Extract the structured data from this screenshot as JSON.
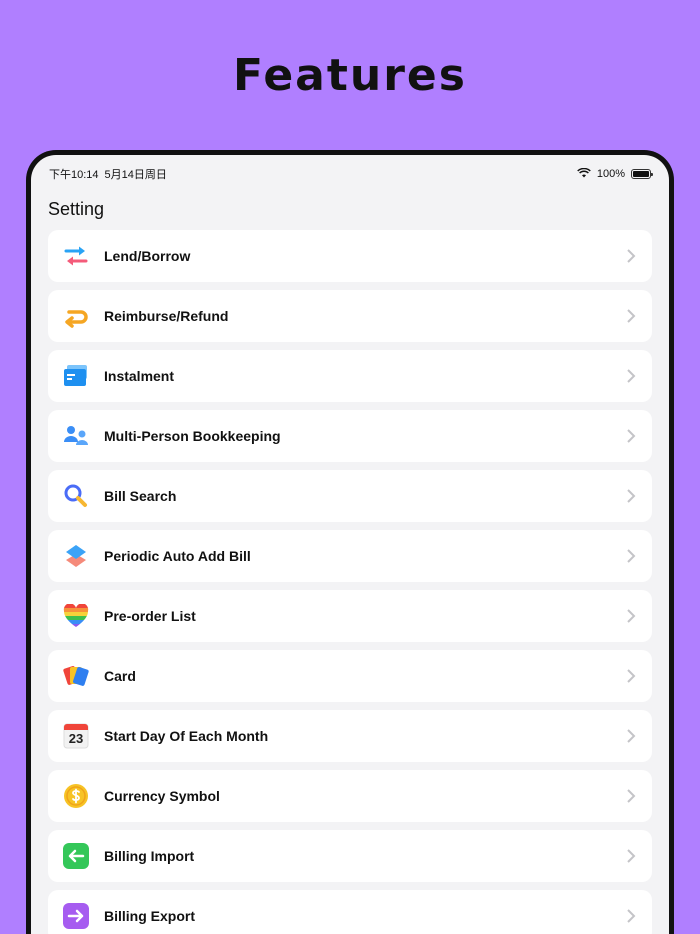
{
  "headline": "Features",
  "status_bar": {
    "time": "下午10:14",
    "date": "5月14日周日",
    "battery": "100%"
  },
  "page_title": "Setting",
  "items": [
    {
      "label": "Lend/Borrow",
      "icon": "lend-borrow-icon"
    },
    {
      "label": "Reimburse/Refund",
      "icon": "reimburse-icon"
    },
    {
      "label": "Instalment",
      "icon": "instalment-icon"
    },
    {
      "label": "Multi-Person Bookkeeping",
      "icon": "people-icon"
    },
    {
      "label": "Bill Search",
      "icon": "search-icon"
    },
    {
      "label": "Periodic Auto Add Bill",
      "icon": "layers-icon"
    },
    {
      "label": "Pre-order List",
      "icon": "heart-icon"
    },
    {
      "label": "Card",
      "icon": "card-icon"
    },
    {
      "label": "Start Day Of Each Month",
      "icon": "calendar-icon",
      "calendar_day": "23"
    },
    {
      "label": "Currency Symbol",
      "icon": "coin-icon"
    },
    {
      "label": "Billing Import",
      "icon": "import-icon"
    },
    {
      "label": "Billing Export",
      "icon": "export-icon"
    }
  ],
  "colors": {
    "background": "#b07fff",
    "import_green": "#34c759",
    "export_purple": "#a65cf0",
    "coin_yellow": "#f7c325",
    "search_blue": "#4a6cf7"
  }
}
